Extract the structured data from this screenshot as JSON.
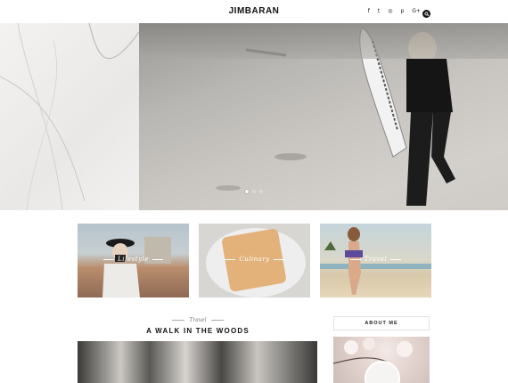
{
  "header": {
    "logo": "JIMBARAN",
    "social_icons": [
      "facebook-icon",
      "twitter-icon",
      "instagram-icon",
      "pinterest-icon",
      "google-plus-icon"
    ],
    "social_glyphs": [
      "f",
      "t",
      "◎",
      "p",
      "G+"
    ]
  },
  "slider": {
    "slide_count": 3,
    "active_slide": 1
  },
  "categories": [
    {
      "label": "Lifestyle"
    },
    {
      "label": "Culinary"
    },
    {
      "label": "Travel"
    }
  ],
  "post": {
    "category": "Travel",
    "title": "A WALK IN THE WOODS"
  },
  "sidebar": {
    "about_title": "ABOUT ME"
  }
}
